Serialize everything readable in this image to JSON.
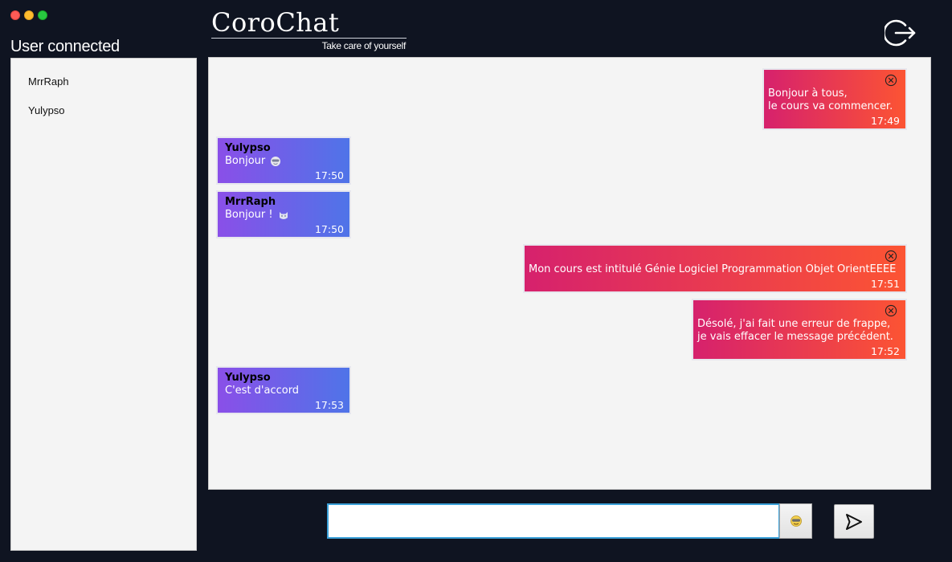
{
  "window": {
    "title": "CoroChat"
  },
  "sidebar": {
    "title": "User connected",
    "users": [
      "MrrRaph",
      "Yulypso"
    ]
  },
  "header": {
    "app_name": "CoroChat",
    "tagline": "Take care of yourself",
    "logout_icon": "logout-icon"
  },
  "messages": [
    {
      "direction": "outgoing",
      "author": "",
      "lines": "Bonjour à tous,\nle cours va commencer.",
      "time": "17:49",
      "deletable": true
    },
    {
      "direction": "incoming",
      "author": "Yulypso",
      "lines": "Bonjour",
      "emoji": "smiling-face-icon",
      "time": "17:50",
      "deletable": false
    },
    {
      "direction": "incoming",
      "author": "MrrRaph",
      "lines": "Bonjour !",
      "emoji": "cat-face-icon",
      "time": "17:50",
      "deletable": false
    },
    {
      "direction": "outgoing",
      "author": "",
      "lines": "Mon cours est intitulé Génie Logiciel Programmation Objet OrientEEEE",
      "time": "17:51",
      "deletable": true
    },
    {
      "direction": "outgoing",
      "author": "",
      "lines": "Désolé, j'ai fait une erreur de frappe,\nje vais effacer le message précédent.",
      "time": "17:52",
      "deletable": true
    },
    {
      "direction": "incoming",
      "author": "Yulypso",
      "lines": "C'est d'accord",
      "time": "17:53",
      "deletable": false
    }
  ],
  "composer": {
    "value": "",
    "placeholder": "",
    "emoji_button_icon": "emoji-picker-icon",
    "send_button_icon": "send-icon"
  },
  "colors": {
    "background": "#0f1421",
    "incoming_gradient": [
      "#8a4fe8",
      "#4f74e8"
    ],
    "outgoing_gradient": [
      "#d6216d",
      "#fc5433"
    ],
    "input_focus": "#3aa0d8"
  }
}
